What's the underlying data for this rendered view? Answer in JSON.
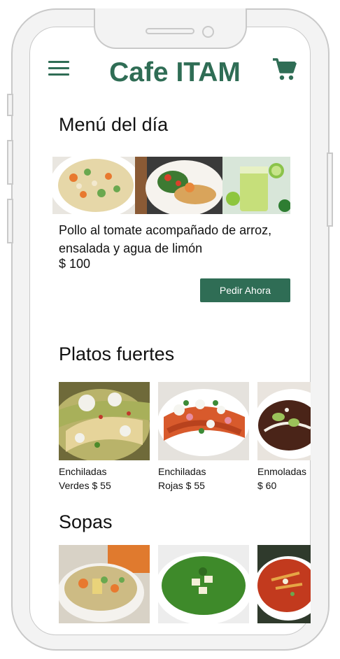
{
  "header": {
    "title": "Cafe ITAM",
    "menu_icon": "hamburger-menu-icon",
    "cart_icon": "shopping-cart-icon",
    "accent_color": "#2f6d55"
  },
  "menu_del_dia": {
    "heading": "Menú del día",
    "description": "Pollo al tomate acompañado de arroz, ensalada y agua de limón",
    "price": "$ 100",
    "button_label": "Pedir Ahora"
  },
  "platos_fuertes": {
    "heading": "Platos fuertes",
    "items": [
      {
        "name": "Enchiladas",
        "detail": "Verdes $ 55"
      },
      {
        "name": "Enchiladas",
        "detail": "Rojas $ 55"
      },
      {
        "name": "Enmoladas",
        "detail": "$ 60"
      }
    ]
  },
  "sopas": {
    "heading": "Sopas"
  }
}
